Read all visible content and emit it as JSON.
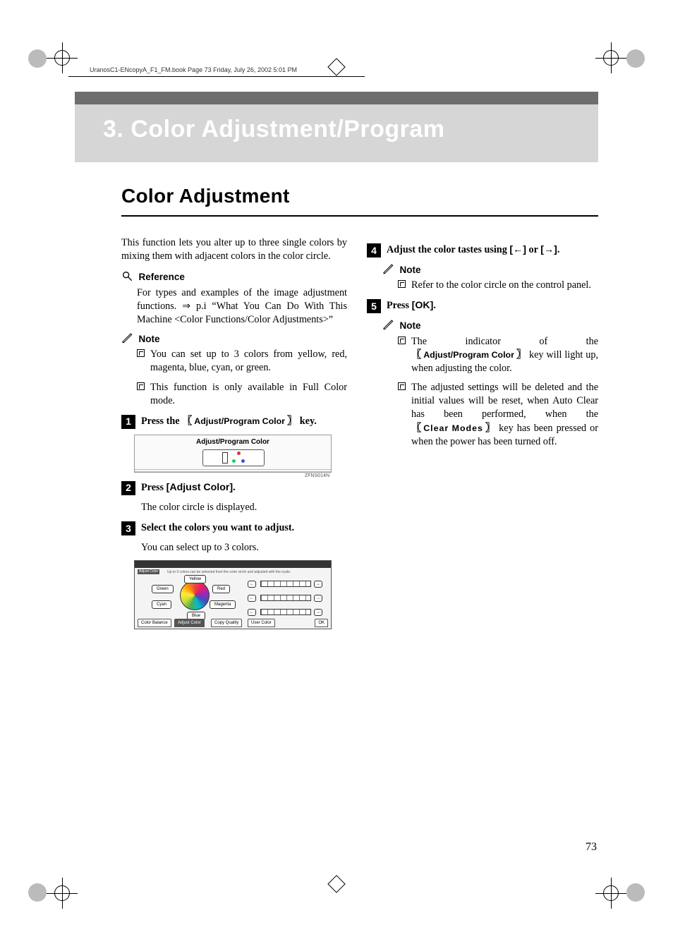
{
  "header_text": "UranosC1-ENcopyA_F1_FM.book  Page 73  Friday, July 26, 2002  5:01 PM",
  "banner_title": "3. Color Adjustment/Program",
  "section_title": "Color Adjustment",
  "left": {
    "intro": "This function lets you alter up to three single colors by mixing them with adjacent colors in the color circle.",
    "reference_label": "Reference",
    "reference_text": "For types and examples of the image adjustment functions. ⇒ p.i “What You Can Do With This Machine <Color Functions/Color Adjustments>”",
    "note_label": "Note",
    "note_items": [
      "You can set up to 3 colors from yellow, red, magenta, blue, cyan, or green.",
      "This function is only available in Full Color mode."
    ],
    "step1_a": "Press the",
    "step1_key": "Adjust/Program Color",
    "step1_b": "key.",
    "panel_label": "Adjust/Program Color",
    "panel_caption": "ZFNS014N",
    "step2_a": "Press",
    "step2_key": "[Adjust Color]",
    "step2_b": ".",
    "step2_sub": "The color circle is displayed.",
    "step3": "Select the colors you want to adjust.",
    "step3_sub": "You can select up to 3 colors.",
    "shot": {
      "title_left": "Adjust Color",
      "title_right": "Up to 3 colors can be selected from the color circle and adjusted with the scale.",
      "t_yellow": "Yellow",
      "t_green": "Green",
      "t_cyan": "Cyan",
      "t_red": "Red",
      "t_magenta": "Magenta",
      "t_blue": "Blue",
      "tabs": [
        "Color Balance",
        "Adjust Color",
        "Copy Quality",
        "User Color"
      ],
      "ok": "OK"
    }
  },
  "right": {
    "step4_a": "Adjust the color tastes using",
    "step4_left": "[←]",
    "step4_or": "or",
    "step4_right": "[→]",
    "step4_end": ".",
    "note_label": "Note",
    "note4_item": "Refer to the color circle on the control panel.",
    "step5_a": "Press",
    "step5_key": "[OK]",
    "step5_b": ".",
    "note5_items_a_pre": "The indicator of the",
    "note5_items_a_key": "Adjust/Program Color",
    "note5_items_a_post": "key will light up, when adjusting the color.",
    "note5_items_b_pre": "The adjusted settings will be deleted and the initial values will be reset, when Auto Clear has been performed, when the",
    "note5_items_b_key": "Clear Modes",
    "note5_items_b_post": "key has been pressed or when the power has been turned off."
  },
  "page_number": "73"
}
